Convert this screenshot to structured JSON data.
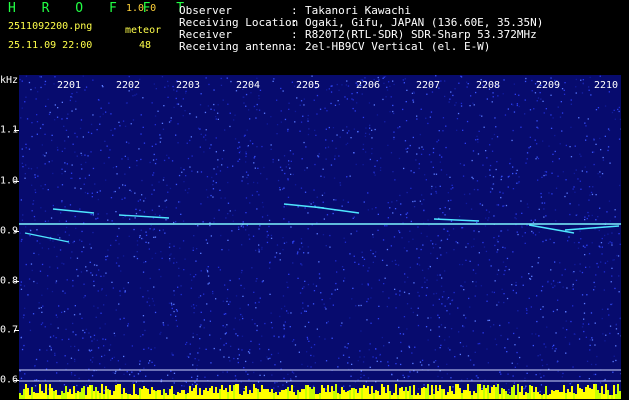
{
  "header": {
    "app_name": "H R O F F T",
    "app_version": "1.0.0",
    "filename": "2511092200.png",
    "datetime": "25.11.09 22:00",
    "meteor_label": "meteor",
    "meteor_count": "48"
  },
  "info": [
    {
      "key": "Observer",
      "value": "Takanori Kawachi"
    },
    {
      "key": "Receiving Location",
      "value": "Ogaki, Gifu, JAPAN (136.60E, 35.35N)"
    },
    {
      "key": "Receiver",
      "value": "R820T2(RTL-SDR) SDR-Sharp 53.372MHz"
    },
    {
      "key": "Receiving antenna",
      "value": "2el-HB9CV Vertical (el. E-W)"
    }
  ],
  "colon": ":",
  "axis": {
    "y_unit": "kHz",
    "x_ticks": [
      "2201",
      "2202",
      "2203",
      "2204",
      "2205",
      "2206",
      "2207",
      "2208",
      "2209",
      "2210"
    ],
    "y_ticks": [
      "1.1",
      "1.0",
      "0.9",
      "0.8",
      "0.7",
      "0.6"
    ]
  },
  "colors": {
    "background": "#000000",
    "plot_bg": "#070b6e",
    "signal": "#3ee8ff",
    "header_green": "#22ff44",
    "header_yellow": "#ffff4a",
    "bottom_bar": "#ffff00"
  }
}
